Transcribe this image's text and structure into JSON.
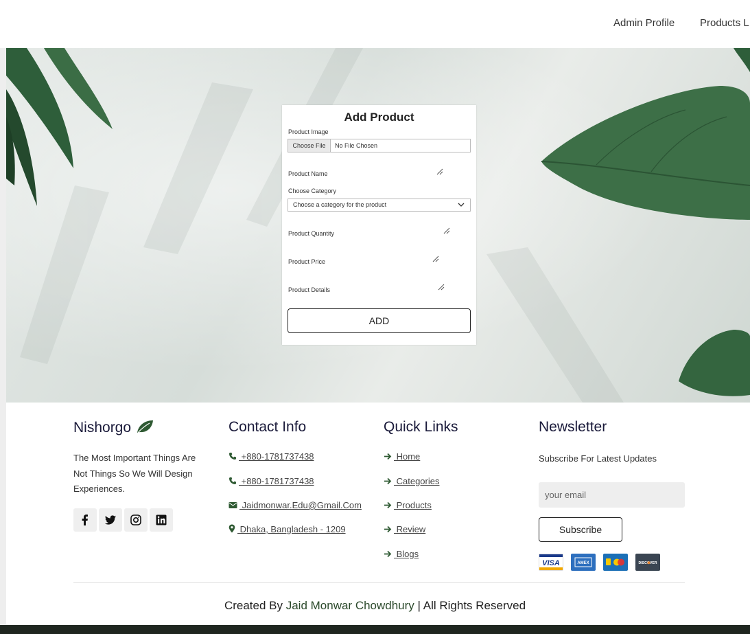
{
  "nav": {
    "admin_profile": "Admin Profile",
    "products_list": "Products L"
  },
  "form": {
    "title": "Add Product",
    "image_label": "Product Image",
    "choose_file": "Choose File",
    "no_file": "No File Chosen",
    "name_label": "Product Name",
    "category_label": "Choose Category",
    "category_placeholder": "Choose a category for the product",
    "quantity_label": "Product Quantity",
    "price_label": "Product Price",
    "details_label": "Product Details",
    "add_button": "ADD"
  },
  "footer": {
    "brand": "Nishorgo",
    "about": "The Most Important Things Are Not Things So We Will Design Experiences.",
    "contact_title": "Contact Info",
    "phone1": " +880-1781737438",
    "phone2": " +880-1781737438",
    "email": " Jaidmonwar.Edu@Gmail.Com",
    "address": " Dhaka, Bangladesh - 1209",
    "links_title": "Quick Links",
    "links": [
      " Home",
      " Categories",
      " Products",
      " Review",
      " Blogs"
    ],
    "newsletter_title": "Newsletter",
    "newsletter_sub": "Subscribe For Latest Updates",
    "email_placeholder": "your email",
    "subscribe": "Subscribe",
    "cards": [
      "VISA",
      "AMEX",
      "MC",
      "DISCOVER"
    ],
    "credit_prefix": "Created By ",
    "credit_name": "Jaid Monwar Chowdhury",
    "credit_suffix": " | All Rights Reserved"
  },
  "colors": {
    "accent_green": "#2f5a33",
    "navy": "#1a1a3a"
  }
}
